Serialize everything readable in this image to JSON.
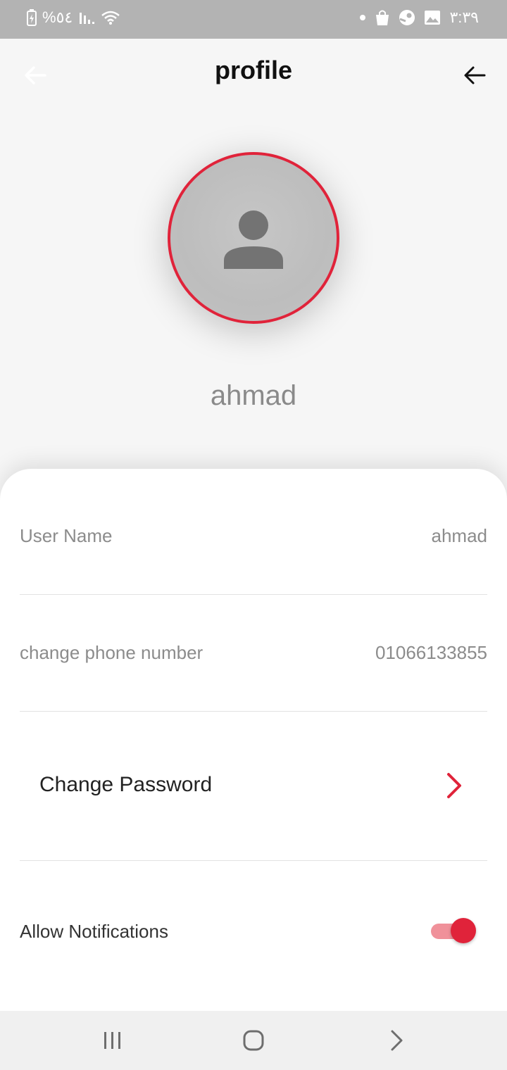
{
  "status_bar": {
    "battery": "%٥٤",
    "time": "٣:٣٩"
  },
  "header": {
    "title": "profile"
  },
  "profile": {
    "display_name": "ahmad"
  },
  "details": {
    "username_label": "User Name",
    "username_value": "ahmad",
    "phone_label": "change phone number",
    "phone_value": "01066133855",
    "change_password_label": "Change Password",
    "notifications_label": "Allow Notifications",
    "notifications_enabled": true
  },
  "colors": {
    "accent": "#e0233a",
    "toggle_track": "#f0919a"
  },
  "icons": {
    "back_left": "arrow-left-icon",
    "back_right": "arrow-left-icon",
    "avatar": "person-icon",
    "chevron": "chevron-right-icon",
    "nav_recents": "recents-icon",
    "nav_home": "home-icon",
    "nav_back": "back-chevron-icon"
  }
}
